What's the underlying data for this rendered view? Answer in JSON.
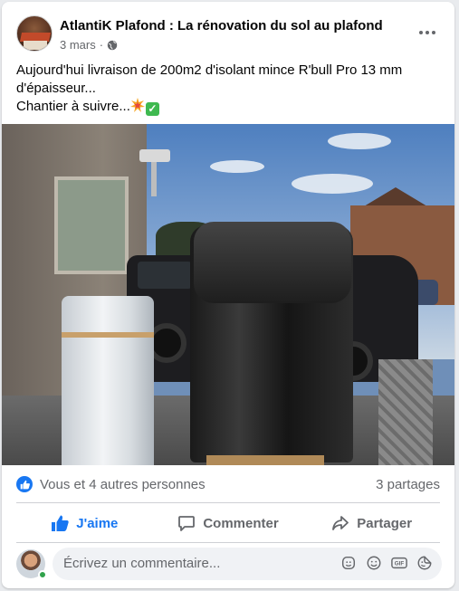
{
  "post": {
    "page_name": "AtlantiK Plafond : La rénovation du sol au plafond",
    "date": "3 mars",
    "separator": "·",
    "text_line1": "Aujourd'hui livraison de 200m2 d'isolant mince R'bull Pro 13 mm",
    "text_line2": "d'épaisseur...",
    "text_line3": "Chantier à suivre...",
    "emoji_1": "collision-emoji",
    "emoji_2": "check-mark-emoji",
    "emoji_2_glyph": "✓"
  },
  "reactions": {
    "text": "Vous et 4 autres personnes",
    "shares": "3 partages"
  },
  "actions": {
    "like": "J'aime",
    "comment": "Commenter",
    "share": "Partager",
    "like_active": true
  },
  "comment": {
    "placeholder": "Écrivez un commentaire..."
  },
  "colors": {
    "accent": "#1877f2",
    "secondary_text": "#65676b",
    "online": "#31a24c"
  }
}
